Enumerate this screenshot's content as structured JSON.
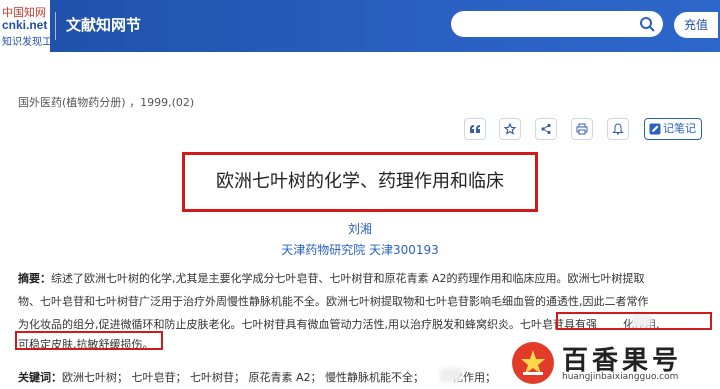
{
  "header": {
    "logo_line1": "中国知网",
    "logo_line2": "cnki.net",
    "logo_line3": "知识发现工程",
    "site_title": "文献知网节",
    "search_placeholder": "",
    "recharge_label": "充值"
  },
  "source": "国外医药(植物药分册) ，1999,(02)",
  "toolbar": {
    "quote_icon": "❝",
    "favorite_icon": "☆",
    "share_icon": "share",
    "print_icon": "print",
    "alert_icon": "bell",
    "note_label": "记笔记"
  },
  "article": {
    "title": "欧洲七叶树的化学、药理作用和临床",
    "author": "刘湘",
    "affiliation": "天津药物研究院 天津300193"
  },
  "abstract": {
    "label": "摘要：",
    "line1": "综述了欧洲七叶树的化学,尤其是主要化学成分七叶皂苷、七叶树苷和原花青素 A2的药理作用和临床应用。欧洲七叶树提取",
    "line2": "物、七叶皂苷和七叶树苷广泛用于治疗外周慢性静脉机能不全。欧洲七叶树提取物和七叶皂苷影响毛细血管的通透性,因此二者常作",
    "line3": "为化妆品的组分,促进微循环和防止皮肤老化。七叶树苷具有微血管动力活性,用以治疗脱发和蜂窝织炎。七叶皂苷具有强",
    "line3_tail": "化作用,",
    "line4": "可稳定皮肤,抗敏舒缓损伤。"
  },
  "keywords": {
    "label": "关键词：",
    "items": "欧洲七叶树；  七叶皂苷；  七叶树苷；  原花青素 A2；  慢性静脉机能不全；",
    "tail": "化作用；"
  },
  "watermark": {
    "text": "百香果号",
    "url": "huangjinbaixiangguo.com"
  },
  "colors": {
    "header_blue": "#2a60c2",
    "highlight_red": "#d11a1a",
    "link_blue": "#2a60c2"
  }
}
